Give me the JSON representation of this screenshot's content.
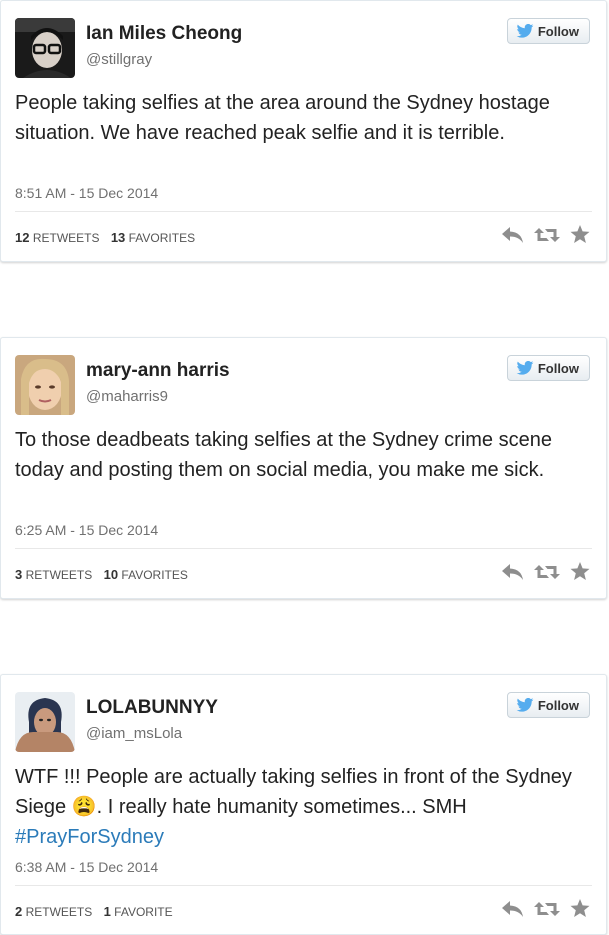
{
  "tweets": [
    {
      "name": "Ian Miles Cheong",
      "handle": "@stillgray",
      "follow_label": "Follow",
      "text": "People taking selfies at the area around the Sydney hostage situation. We have reached peak selfie and it is terrible.",
      "hashtag": "",
      "timestamp": "8:51 AM - 15 Dec 2014",
      "retweets_count": "12",
      "retweets_label": "RETWEETS",
      "favorites_count": "13",
      "favorites_label": "FAVORITES"
    },
    {
      "name": "mary-ann harris",
      "handle": "@maharris9",
      "follow_label": "Follow",
      "text": "To those deadbeats taking selfies at the Sydney crime scene today and posting them on social media, you make me sick.",
      "hashtag": "",
      "timestamp": "6:25 AM - 15 Dec 2014",
      "retweets_count": "3",
      "retweets_label": "RETWEETS",
      "favorites_count": "10",
      "favorites_label": "FAVORITES"
    },
    {
      "name": "LOLABUNNYY",
      "handle": "@iam_msLola",
      "follow_label": "Follow",
      "text": "WTF !!! People are actually taking selfies in front of the Sydney Siege 😩. I really hate humanity sometimes... SMH",
      "hashtag": "#PrayForSydney",
      "timestamp": "6:38 AM - 15 Dec 2014",
      "retweets_count": "2",
      "retweets_label": "RETWEETS",
      "favorites_count": "1",
      "favorites_label": "FAVORITE"
    }
  ],
  "icons": {
    "follow": "twitter-bird-icon",
    "reply": "reply-icon",
    "retweet": "retweet-icon",
    "favorite": "favorite-star-icon"
  },
  "colors": {
    "brand_blue": "#55acee",
    "hashtag": "#2b7bb9",
    "action_gray": "#8e8e8e"
  }
}
